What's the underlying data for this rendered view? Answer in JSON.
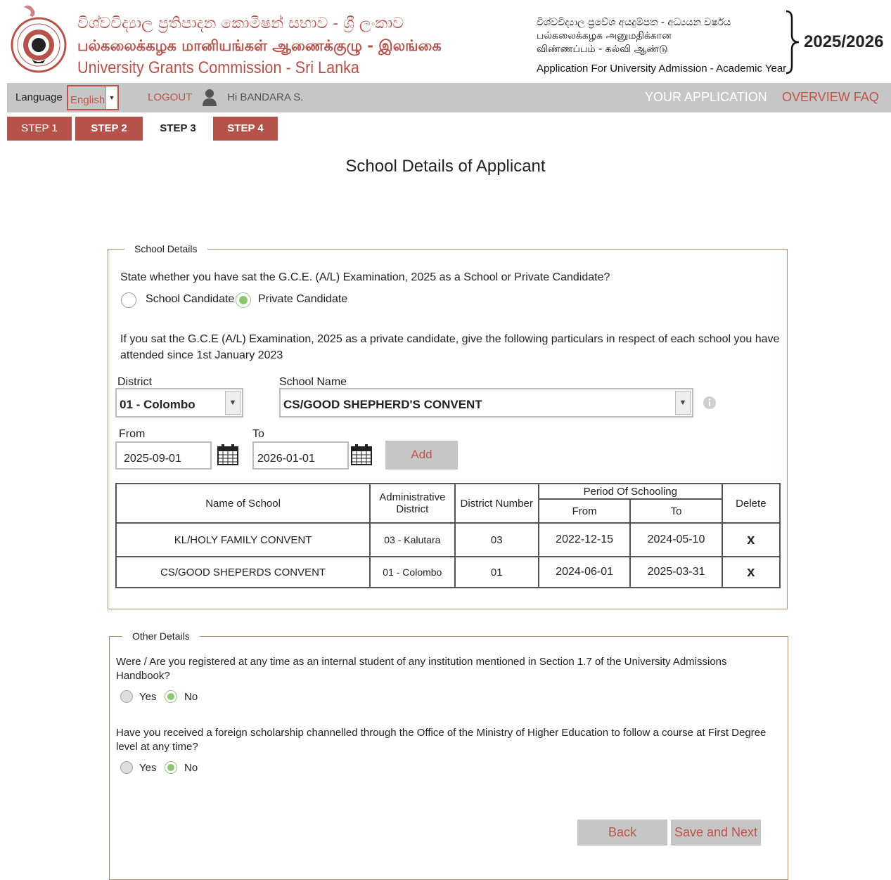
{
  "header": {
    "title_sinhala": "විශ්වවිද්‍යාල ප්‍රතිපාදන කොමිෂන් සභාව - ශ්‍රී ලංකාව",
    "title_tamil": "பல்கலைக்கழக மானியங்கள் ஆணைக்குழு - இலங்கை",
    "title_english": "University Grants Commission - Sri Lanka",
    "app_line_sinhala": "විශ්වවිද්‍යාල ප්‍රවේශ අයදුම්පත - අධ්‍යයන වර්ෂය",
    "app_line_tamil_1": "பல்கலைக்கழக அனுமதிக்கான",
    "app_line_tamil_2": "விண்ணப்பம் - கல்வி ஆண்டு",
    "app_line_english": "Application For University Admission - Academic Year",
    "year": "2025/2026"
  },
  "nav": {
    "language_label": "Language",
    "language_value": "English",
    "logout": "LOGOUT",
    "greeting": "Hi BANDARA S.",
    "your_application": "YOUR APPLICATION",
    "overview_faq": "OVERVIEW FAQ"
  },
  "steps": [
    "STEP 1",
    "STEP 2",
    "STEP 3",
    "STEP 4"
  ],
  "page_title": "School Details of Applicant",
  "school_details": {
    "legend": "School Details",
    "question": "State whether you have sat the G.C.E. (A/L) Examination, 2025 as a School or Private Candidate?",
    "option_school": "School Candidate",
    "option_private": "Private Candidate",
    "selected": "Private Candidate",
    "instruction_line1": "If you sat the G.C.E (A/L) Examination, 2025 as a private candidate, give the following particulars in respect of each school you have",
    "instruction_line2": "attended since 1st January 2023",
    "district_label": "District",
    "district_value": "01 - Colombo",
    "school_label": "School Name",
    "school_value": "CS/GOOD SHEPHERD'S CONVENT",
    "from_label": "From",
    "from_value": "2025-09-01",
    "to_label": "To",
    "to_value": "2026-01-01",
    "add_button": "Add",
    "table": {
      "col_school": "Name of School",
      "col_admin_1": "Administrative",
      "col_admin_2": "District",
      "col_district_no": "District Number",
      "col_period": "Period Of Schooling",
      "col_from": "From",
      "col_to": "To",
      "col_delete": "Delete",
      "rows": [
        {
          "school": "KL/HOLY FAMILY CONVENT",
          "admin": "03 - Kalutara",
          "district_no": "03",
          "from": "2022-12-15",
          "to": "2024-05-10",
          "delete": "x"
        },
        {
          "school": "CS/GOOD SHEPERDS CONVENT",
          "admin": "01 - Colombo",
          "district_no": "01",
          "from": "2024-06-01",
          "to": "2025-03-31",
          "delete": "x"
        }
      ]
    }
  },
  "other_details": {
    "legend": "Other Details",
    "q1_line1": "Were / Are you registered at any time as an internal student of any institution mentioned in Section 1.7 of the University Admissions",
    "q1_line2": "Handbook?",
    "q2_line1": "Have you received a foreign scholarship channelled through the Office of the Ministry of Higher Education to follow a course at First Degree",
    "q2_line2": "level at any time?",
    "yes": "Yes",
    "no": "No",
    "q1_selected": "No",
    "q2_selected": "No"
  },
  "buttons": {
    "back": "Back",
    "save_next": "Save and Next"
  },
  "colors": {
    "brand": "#b5534a",
    "nav_bg": "#c6c6c6",
    "radio_selected": "#8cc66d",
    "border": "#b78a6a"
  },
  "icons": [
    "ugc-logo-icon",
    "user-icon",
    "info-icon",
    "calendar-icon",
    "chevron-down-icon",
    "delete-icon"
  ]
}
